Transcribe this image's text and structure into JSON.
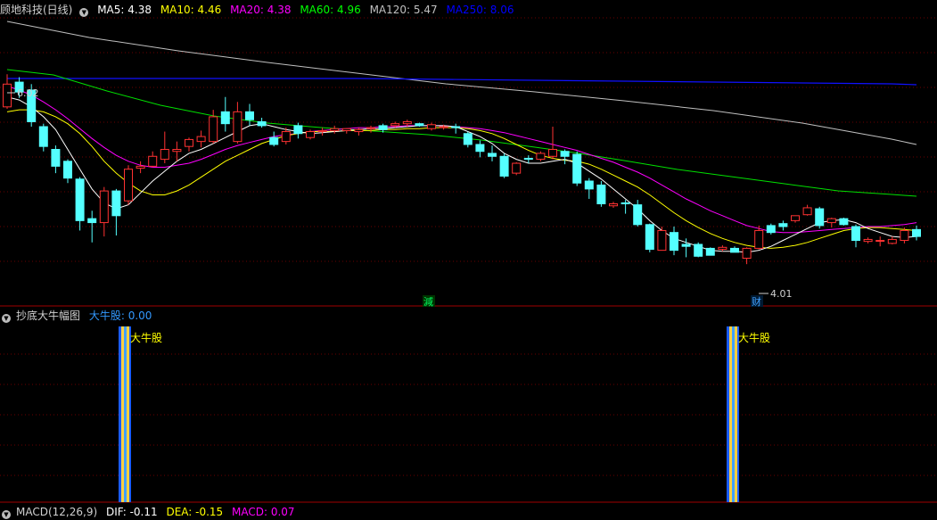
{
  "main_legend": {
    "title": "顾地科技(日线)",
    "ma": [
      {
        "label": "MA5: 4.38",
        "color": "#ffffff"
      },
      {
        "label": "MA10: 4.46",
        "color": "#ffff00"
      },
      {
        "label": "MA20: 4.38",
        "color": "#ff00ff"
      },
      {
        "label": "MA60: 4.96",
        "color": "#00ff00"
      },
      {
        "label": "MA120: 5.47",
        "color": "#c0c0c0"
      },
      {
        "label": "MA250: 8.06",
        "color": "#0000ff"
      }
    ]
  },
  "sub_legend": {
    "title": "抄底大牛幅图",
    "value_label": "大牛股: 0.00",
    "value_color": "#3399ff"
  },
  "bottom_legend": {
    "title": "MACD(12,26,9)",
    "items": [
      {
        "label": "DIF: -0.11",
        "color": "#ffffff"
      },
      {
        "label": "DEA: -0.15",
        "color": "#ffff00"
      },
      {
        "label": "MACD: 0.07",
        "color": "#ff00ff"
      }
    ]
  },
  "chart_data": {
    "type": "candlestick",
    "ylim": [
      3.7,
      6.45
    ],
    "colors": {
      "up": "#ff3232",
      "down": "#54ffff",
      "ma5": "#ffffff",
      "ma10": "#ffff00",
      "ma20": "#ff00ff",
      "ma60": "#00ff00",
      "ma120": "#c0c0c0",
      "ma250": "#0000ff"
    },
    "candles": [
      [
        5.55,
        5.78,
        5.88,
        5.53
      ],
      [
        5.8,
        5.7,
        5.85,
        5.64
      ],
      [
        5.72,
        5.4,
        5.78,
        5.35
      ],
      [
        5.35,
        5.15,
        5.38,
        5.1
      ],
      [
        5.12,
        4.95,
        5.16,
        4.88
      ],
      [
        5.0,
        4.83,
        5.02,
        4.78
      ],
      [
        4.82,
        4.4,
        4.84,
        4.3
      ],
      [
        4.42,
        4.38,
        4.5,
        4.18
      ],
      [
        4.38,
        4.7,
        4.74,
        4.24
      ],
      [
        4.7,
        4.45,
        4.72,
        4.25
      ],
      [
        4.6,
        4.92,
        4.96,
        4.56
      ],
      [
        4.93,
        4.95,
        5.0,
        4.88
      ],
      [
        4.95,
        5.05,
        5.1,
        4.94
      ],
      [
        5.02,
        5.12,
        5.3,
        4.98
      ],
      [
        5.1,
        5.12,
        5.2,
        5.0
      ],
      [
        5.15,
        5.22,
        5.24,
        5.1
      ],
      [
        5.2,
        5.25,
        5.31,
        5.14
      ],
      [
        5.2,
        5.45,
        5.52,
        5.18
      ],
      [
        5.5,
        5.38,
        5.65,
        5.3
      ],
      [
        5.2,
        5.5,
        5.6,
        5.18
      ],
      [
        5.5,
        5.42,
        5.58,
        5.36
      ],
      [
        5.4,
        5.36,
        5.44,
        5.34
      ],
      [
        5.24,
        5.17,
        5.3,
        5.15
      ],
      [
        5.2,
        5.3,
        5.34,
        5.17
      ],
      [
        5.36,
        5.28,
        5.39,
        5.23
      ],
      [
        5.24,
        5.3,
        5.32,
        5.22
      ],
      [
        5.3,
        5.31,
        5.34,
        5.26
      ],
      [
        5.31,
        5.33,
        5.36,
        5.28
      ],
      [
        5.31,
        5.33,
        5.33,
        5.28
      ],
      [
        5.3,
        5.32,
        5.34,
        5.26
      ],
      [
        5.33,
        5.34,
        5.36,
        5.29
      ],
      [
        5.36,
        5.32,
        5.38,
        5.29
      ],
      [
        5.36,
        5.38,
        5.4,
        5.34
      ],
      [
        5.38,
        5.4,
        5.42,
        5.35
      ],
      [
        5.38,
        5.36,
        5.39,
        5.35
      ],
      [
        5.33,
        5.37,
        5.39,
        5.31
      ],
      [
        5.34,
        5.35,
        5.37,
        5.32
      ],
      [
        5.35,
        5.34,
        5.38,
        5.28
      ],
      [
        5.28,
        5.17,
        5.3,
        5.14
      ],
      [
        5.17,
        5.1,
        5.21,
        5.04
      ],
      [
        5.08,
        5.05,
        5.16,
        5.0
      ],
      [
        5.05,
        4.85,
        5.08,
        4.83
      ],
      [
        4.88,
        4.98,
        4.99,
        4.86
      ],
      [
        5.03,
        5.02,
        5.06,
        4.98
      ],
      [
        5.02,
        5.08,
        5.1,
        5.0
      ],
      [
        5.05,
        5.12,
        5.35,
        5.02
      ],
      [
        5.1,
        5.05,
        5.12,
        4.97
      ],
      [
        5.07,
        4.78,
        5.1,
        4.75
      ],
      [
        4.8,
        4.72,
        4.83,
        4.62
      ],
      [
        4.76,
        4.57,
        4.8,
        4.54
      ],
      [
        4.55,
        4.57,
        4.59,
        4.53
      ],
      [
        4.58,
        4.57,
        4.61,
        4.47
      ],
      [
        4.56,
        4.36,
        4.61,
        4.34
      ],
      [
        4.36,
        4.11,
        4.37,
        4.08
      ],
      [
        4.1,
        4.3,
        4.34,
        4.1
      ],
      [
        4.28,
        4.1,
        4.34,
        4.05
      ],
      [
        4.16,
        4.14,
        4.22,
        4.03
      ],
      [
        4.16,
        4.04,
        4.18,
        4.03
      ],
      [
        4.12,
        4.05,
        4.13,
        4.07
      ],
      [
        4.11,
        4.13,
        4.15,
        4.09
      ],
      [
        4.12,
        4.08,
        4.14,
        4.09
      ],
      [
        4.02,
        4.12,
        4.13,
        3.96
      ],
      [
        4.12,
        4.3,
        4.35,
        4.11
      ],
      [
        4.35,
        4.28,
        4.37,
        4.26
      ],
      [
        4.37,
        4.34,
        4.4,
        4.3
      ],
      [
        4.4,
        4.45,
        4.45,
        4.38
      ],
      [
        4.46,
        4.53,
        4.56,
        4.45
      ],
      [
        4.52,
        4.35,
        4.54,
        4.32
      ],
      [
        4.38,
        4.42,
        4.43,
        4.33
      ],
      [
        4.42,
        4.36,
        4.43,
        4.35
      ],
      [
        4.34,
        4.2,
        4.36,
        4.13
      ],
      [
        4.19,
        4.21,
        4.23,
        4.17
      ],
      [
        4.2,
        4.2,
        4.24,
        4.14
      ],
      [
        4.17,
        4.21,
        4.24,
        4.16
      ],
      [
        4.2,
        4.3,
        4.33,
        4.17
      ],
      [
        4.31,
        4.24,
        4.35,
        4.2
      ]
    ],
    "ma5": [
      5.65,
      5.62,
      5.55,
      5.45,
      5.32,
      5.12,
      4.92,
      4.72,
      4.58,
      4.52,
      4.56,
      4.68,
      4.8,
      4.9,
      5.0,
      5.08,
      5.12,
      5.18,
      5.24,
      5.3,
      5.36,
      5.38,
      5.35,
      5.32,
      5.3,
      5.28,
      5.29,
      5.3,
      5.31,
      5.32,
      5.33,
      5.33,
      5.34,
      5.35,
      5.36,
      5.36,
      5.36,
      5.35,
      5.3,
      5.25,
      5.18,
      5.08,
      5.02,
      4.98,
      4.98,
      5.0,
      5.02,
      4.98,
      4.9,
      4.82,
      4.72,
      4.62,
      4.52,
      4.4,
      4.3,
      4.22,
      4.18,
      4.14,
      4.1,
      4.09,
      4.09,
      4.08,
      4.1,
      4.14,
      4.2,
      4.26,
      4.32,
      4.38,
      4.4,
      4.41,
      4.38,
      4.32,
      4.28,
      4.24,
      4.23,
      4.24
    ],
    "ma10": [
      5.5,
      5.52,
      5.52,
      5.5,
      5.45,
      5.38,
      5.28,
      5.15,
      5.0,
      4.88,
      4.78,
      4.7,
      4.66,
      4.66,
      4.7,
      4.76,
      4.84,
      4.92,
      5.0,
      5.06,
      5.12,
      5.18,
      5.22,
      5.26,
      5.28,
      5.3,
      5.3,
      5.3,
      5.31,
      5.31,
      5.31,
      5.32,
      5.32,
      5.33,
      5.33,
      5.34,
      5.34,
      5.34,
      5.33,
      5.31,
      5.28,
      5.23,
      5.17,
      5.11,
      5.06,
      5.03,
      5.01,
      5.0,
      4.97,
      4.92,
      4.86,
      4.8,
      4.74,
      4.66,
      4.57,
      4.48,
      4.4,
      4.33,
      4.27,
      4.22,
      4.18,
      4.15,
      4.13,
      4.12,
      4.13,
      4.15,
      4.18,
      4.22,
      4.26,
      4.3,
      4.32,
      4.33,
      4.33,
      4.32,
      4.31,
      4.3
    ],
    "ma20": [
      5.76,
      5.72,
      5.67,
      5.6,
      5.52,
      5.43,
      5.33,
      5.23,
      5.14,
      5.06,
      5.0,
      4.96,
      4.94,
      4.94,
      4.96,
      4.98,
      5.02,
      5.07,
      5.12,
      5.16,
      5.19,
      5.22,
      5.25,
      5.27,
      5.28,
      5.3,
      5.31,
      5.32,
      5.33,
      5.34,
      5.34,
      5.35,
      5.35,
      5.36,
      5.36,
      5.36,
      5.36,
      5.35,
      5.34,
      5.33,
      5.31,
      5.29,
      5.26,
      5.23,
      5.2,
      5.17,
      5.14,
      5.11,
      5.07,
      5.03,
      4.99,
      4.94,
      4.89,
      4.83,
      4.76,
      4.69,
      4.62,
      4.56,
      4.5,
      4.45,
      4.4,
      4.35,
      4.32,
      4.29,
      4.28,
      4.28,
      4.29,
      4.3,
      4.31,
      4.32,
      4.33,
      4.34,
      4.34,
      4.35,
      4.36,
      4.38
    ]
  }
}
